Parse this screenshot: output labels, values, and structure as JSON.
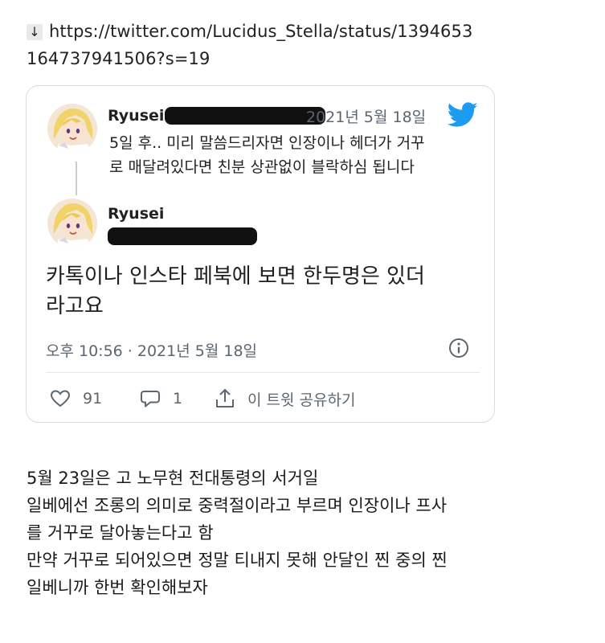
{
  "link": {
    "arrow": "↓",
    "line1": "https://twitter.com/Lucidus_Stella/status/1394653",
    "line2": "164737941506?s=19"
  },
  "tweet_card": {
    "reply": {
      "name": "Ryusei",
      "date": "2021년 5월 18일",
      "text_line1": "5일 후.. 미리 말씀드리자면 인장이나 헤더가 거꾸",
      "text_line2": "로 매달려있다면 친분 상관없이 블락하심 됩니다",
      "avatar_icon": "anime-avatar-icon",
      "brand_icon": "twitter-bird-icon",
      "brand_color": "#1d9bf0"
    },
    "main": {
      "name": "Ryusei",
      "text_line1": "카톡이나 인스타 페북에 보면 한두명은 있더",
      "text_line2": "라고요",
      "timestamp": "오후 10:56 · 2021년 5월 18일"
    },
    "actions": {
      "like_count": "91",
      "reply_count": "1",
      "share_label": "이 트윗 공유하기"
    }
  },
  "body": {
    "lines": [
      "5월 23일은 고 노무현 전대통령의 서거일",
      "일베에선 조롱의 의미로 중력절이라고 부르며 인장이나 프사",
      "를 거꾸로 달아놓는다고 함",
      "만약 거꾸로 되어있으면 정말 티내지 못해 안달인 찐 중의 찐",
      "일베니까 한번 확인해보자"
    ]
  }
}
